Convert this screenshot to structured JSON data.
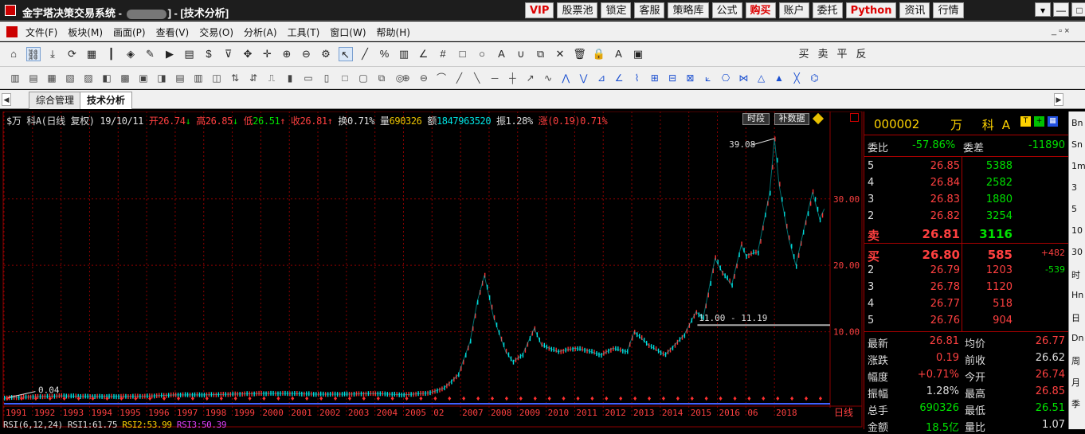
{
  "window": {
    "title_prefix": "金宇塔决策交易系统 - ",
    "title_suffix": "] - [技术分析]"
  },
  "top_buttons": [
    {
      "label": "VIP",
      "style": "red"
    },
    {
      "label": "股票池",
      "style": ""
    },
    {
      "label": "锁定",
      "style": ""
    },
    {
      "label": "客服",
      "style": ""
    },
    {
      "label": "策略库",
      "style": ""
    },
    {
      "label": "公式",
      "style": ""
    },
    {
      "label": "购买",
      "style": "red"
    },
    {
      "label": "账户",
      "style": ""
    },
    {
      "label": "委托",
      "style": ""
    },
    {
      "label": "Python",
      "style": "red"
    },
    {
      "label": "资讯",
      "style": ""
    },
    {
      "label": "行情",
      "style": ""
    }
  ],
  "window_controls": {
    "menu": "▾",
    "minimize": "—",
    "maximize": "□",
    "close": "✕"
  },
  "menu": [
    "文件(F)",
    "板块(M)",
    "画面(P)",
    "查看(V)",
    "交易(O)",
    "分析(A)",
    "工具(T)",
    "窗口(W)",
    "帮助(H)"
  ],
  "mdi_controls": "_ ▫ ×",
  "toolbar1": [
    {
      "name": "home-icon",
      "glyph": "⌂"
    },
    {
      "name": "link-icon",
      "glyph": "⛓"
    },
    {
      "name": "download-icon",
      "glyph": "⤓"
    },
    {
      "name": "refresh-icon",
      "glyph": "⟳"
    },
    {
      "name": "grid-icon",
      "glyph": "▦"
    },
    {
      "name": "candle-icon",
      "glyph": "┃"
    },
    {
      "name": "diamond-icon",
      "glyph": "◈"
    },
    {
      "name": "edit-icon",
      "glyph": "✎"
    },
    {
      "name": "play-icon",
      "glyph": "▶"
    },
    {
      "name": "page-icon",
      "glyph": "▤"
    },
    {
      "name": "dollar-icon",
      "glyph": "$"
    },
    {
      "name": "filter-icon",
      "glyph": "⊽"
    },
    {
      "name": "move-icon",
      "glyph": "✥"
    },
    {
      "name": "crosshair-icon",
      "glyph": "✛"
    },
    {
      "name": "zoom-in-icon",
      "glyph": "⊕"
    },
    {
      "name": "zoom-out-icon",
      "glyph": "⊖"
    },
    {
      "name": "settings-icon",
      "glyph": "⚙"
    },
    {
      "name": "cursor-icon",
      "glyph": "↖"
    },
    {
      "name": "line-icon",
      "glyph": "╱"
    },
    {
      "name": "percent-icon",
      "glyph": "%"
    },
    {
      "name": "ruler-icon",
      "glyph": "▥"
    },
    {
      "name": "angle-icon",
      "glyph": "∠"
    },
    {
      "name": "hash-icon",
      "glyph": "#"
    },
    {
      "name": "rect-icon",
      "glyph": "□"
    },
    {
      "name": "circle-icon",
      "glyph": "○"
    },
    {
      "name": "text-icon",
      "glyph": "A"
    },
    {
      "name": "magnet-icon",
      "glyph": "∪"
    },
    {
      "name": "copy-icon",
      "glyph": "⧉"
    },
    {
      "name": "delete-icon",
      "glyph": "✕"
    },
    {
      "name": "trash-icon",
      "glyph": "🗑"
    },
    {
      "name": "lock-icon",
      "glyph": "🔒"
    },
    {
      "name": "color-icon",
      "glyph": "A"
    },
    {
      "name": "save-icon",
      "glyph": "▣"
    }
  ],
  "toolbar1_trade": [
    "买",
    "卖",
    "平",
    "反"
  ],
  "toolbar2_count": 60,
  "tabs": [
    "综合管理",
    "技术分析"
  ],
  "info": {
    "symbol": "$万  科A(日线 复权)",
    "date": "19/10/11",
    "open_label": "开",
    "open": "26.74",
    "high_label": "高",
    "high": "26.85",
    "low_label": "低",
    "low": "26.51",
    "close_label": "收",
    "close": "26.81",
    "turnover_label": "换",
    "turnover": "0.71%",
    "vol_label": "量",
    "vol": "690326",
    "amount_label": "额",
    "amount": "1847963520",
    "amp_label": "振",
    "amp": "1.28%",
    "chg_label": "涨",
    "chg": "(0.19)0.71%"
  },
  "chart_buttons": {
    "time_seg": "时段",
    "fill_data": "补数据"
  },
  "chart_data": {
    "type": "line",
    "x_labels": [
      "1991",
      "1992",
      "1993",
      "1994",
      "1995",
      "1996",
      "1997",
      "1998",
      "1999",
      "2000",
      "2001",
      "2002",
      "2003",
      "2004",
      "2005",
      "02",
      "2007",
      "2008",
      "2009",
      "2010",
      "2011",
      "2012",
      "2013",
      "2014",
      "2015",
      "2016",
      "06",
      "2018"
    ],
    "y_ticks": [
      "30.00",
      "20.00",
      "10.00"
    ],
    "period_label": "日线",
    "points": [
      [
        "1991-01",
        0.04
      ],
      [
        "1992-01",
        0.2
      ],
      [
        "1993-01",
        0.35
      ],
      [
        "1994-01",
        0.25
      ],
      [
        "1995-01",
        0.25
      ],
      [
        "1996-01",
        0.3
      ],
      [
        "1997-01",
        0.5
      ],
      [
        "1998-01",
        0.5
      ],
      [
        "1999-01",
        0.6
      ],
      [
        "2000-01",
        0.7
      ],
      [
        "2001-01",
        0.7
      ],
      [
        "2002-01",
        0.6
      ],
      [
        "2003-01",
        0.6
      ],
      [
        "2004-01",
        0.7
      ],
      [
        "2005-01",
        0.5
      ],
      [
        "2005-12",
        0.8
      ],
      [
        "2006-06",
        1.5
      ],
      [
        "2006-12",
        3.5
      ],
      [
        "2007-05",
        8.5
      ],
      [
        "2007-08",
        14.5
      ],
      [
        "2007-11",
        18.5
      ],
      [
        "2008-03",
        12.0
      ],
      [
        "2008-08",
        7.0
      ],
      [
        "2008-11",
        5.5
      ],
      [
        "2009-03",
        6.5
      ],
      [
        "2009-08",
        10.5
      ],
      [
        "2009-11",
        8.0
      ],
      [
        "2010-06",
        7.0
      ],
      [
        "2011-01",
        7.5
      ],
      [
        "2011-06",
        7.2
      ],
      [
        "2011-12",
        6.5
      ],
      [
        "2012-05",
        7.5
      ],
      [
        "2012-11",
        7.0
      ],
      [
        "2013-02",
        10.0
      ],
      [
        "2013-08",
        8.0
      ],
      [
        "2014-03",
        6.5
      ],
      [
        "2014-11",
        9.5
      ],
      [
        "2015-04",
        13.0
      ],
      [
        "2015-07",
        12.0
      ],
      [
        "2015-12",
        21.0
      ],
      [
        "2016-03",
        19.0
      ],
      [
        "2016-07",
        17.0
      ],
      [
        "2016-11",
        23.0
      ],
      [
        "2017-01",
        21.5
      ],
      [
        "2017-06",
        22.0
      ],
      [
        "2017-11",
        31.0
      ],
      [
        "2018-01",
        39.08
      ],
      [
        "2018-03",
        32.0
      ],
      [
        "2018-07",
        24.0
      ],
      [
        "2018-10",
        20.0
      ],
      [
        "2019-03",
        28.0
      ],
      [
        "2019-05",
        31.0
      ],
      [
        "2019-08",
        27.0
      ],
      [
        "2019-10",
        28.5
      ]
    ],
    "annotations": {
      "max": "39.08",
      "min": "0.04",
      "range": "11.00 - 11.19"
    },
    "indicator": {
      "title": "RSI(6,12,24)",
      "rsi1": "RSI1:61.75",
      "rsi2": "RSI2:53.99",
      "rsi3": "RSI3:50.39"
    }
  },
  "quote": {
    "code": "000002",
    "name": "万 科A",
    "ratio_label": "委比",
    "ratio": "-57.86%",
    "diff_label": "委差",
    "diff": "-11890",
    "sell": [
      {
        "label": "5",
        "price": "26.85",
        "vol": "5388"
      },
      {
        "label": "4",
        "price": "26.84",
        "vol": "2582"
      },
      {
        "label": "3",
        "price": "26.83",
        "vol": "1880"
      },
      {
        "label": "2",
        "price": "26.82",
        "vol": "3254"
      },
      {
        "label": "卖",
        "price": "26.81",
        "vol": "3116"
      }
    ],
    "buy": [
      {
        "label": "买",
        "price": "26.80",
        "vol": "585",
        "chg": "+482"
      },
      {
        "label": "2",
        "price": "26.79",
        "vol": "1203",
        "chg": "-539"
      },
      {
        "label": "3",
        "price": "26.78",
        "vol": "1120",
        "chg": ""
      },
      {
        "label": "4",
        "price": "26.77",
        "vol": "518",
        "chg": ""
      },
      {
        "label": "5",
        "price": "26.76",
        "vol": "904",
        "chg": ""
      }
    ],
    "stats": [
      {
        "l1": "最新",
        "v1": "26.81",
        "c1": "r",
        "l2": "均价",
        "v2": "26.77",
        "c2": "r"
      },
      {
        "l1": "涨跌",
        "v1": "0.19",
        "c1": "r",
        "l2": "前收",
        "v2": "26.62",
        "c2": "w"
      },
      {
        "l1": "幅度",
        "v1": "+0.71%",
        "c1": "r",
        "l2": "今开",
        "v2": "26.74",
        "c2": "r"
      },
      {
        "l1": "振幅",
        "v1": "1.28%",
        "c1": "w",
        "l2": "最高",
        "v2": "26.85",
        "c2": "r"
      },
      {
        "l1": "总手",
        "v1": "690326",
        "c1": "g",
        "l2": "最低",
        "v2": "26.51",
        "c2": "g"
      },
      {
        "l1": "金额",
        "v1": "18.5亿",
        "c1": "g",
        "l2": "量比",
        "v2": "1.07",
        "c2": "w"
      }
    ]
  },
  "right_strip": [
    "Bn",
    "Sn",
    "1m",
    "3",
    "5",
    "10",
    "30",
    "时",
    "Hn",
    "日",
    "Dn",
    "周",
    "月",
    "季"
  ],
  "colors": {
    "up": "#ff3030",
    "down": "#00e0e0",
    "grid": "#8b0000",
    "accent": "#ffd400"
  }
}
